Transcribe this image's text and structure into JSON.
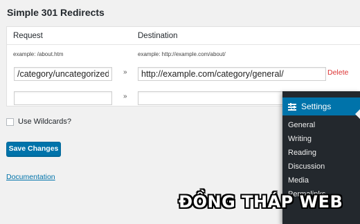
{
  "page": {
    "title": "Simple 301 Redirects"
  },
  "table": {
    "header_request": "Request",
    "header_destination": "Destination",
    "example_request": "example: /about.htm",
    "example_destination": "example: http://example.com/about/",
    "rows": [
      {
        "request": "/category/uncategorized/",
        "destination": "http://example.com/category/general/",
        "arrow": "»",
        "delete": "Delete"
      },
      {
        "request": "",
        "destination": "",
        "arrow": "»",
        "delete": ""
      }
    ]
  },
  "wildcards": {
    "label": "Use Wildcards?",
    "checked": false
  },
  "actions": {
    "save_label": "Save Changes"
  },
  "links": {
    "documentation": "Documentation"
  },
  "settings_menu": {
    "title": "Settings",
    "icon": "settings-icon",
    "items": [
      "General",
      "Writing",
      "Reading",
      "Discussion",
      "Media",
      "Permalinks"
    ]
  },
  "watermark": "ĐỒNG THÁP WEB",
  "colors": {
    "accent": "#0073aa",
    "delete": "#dc3232",
    "menu_bg": "#23282d"
  }
}
